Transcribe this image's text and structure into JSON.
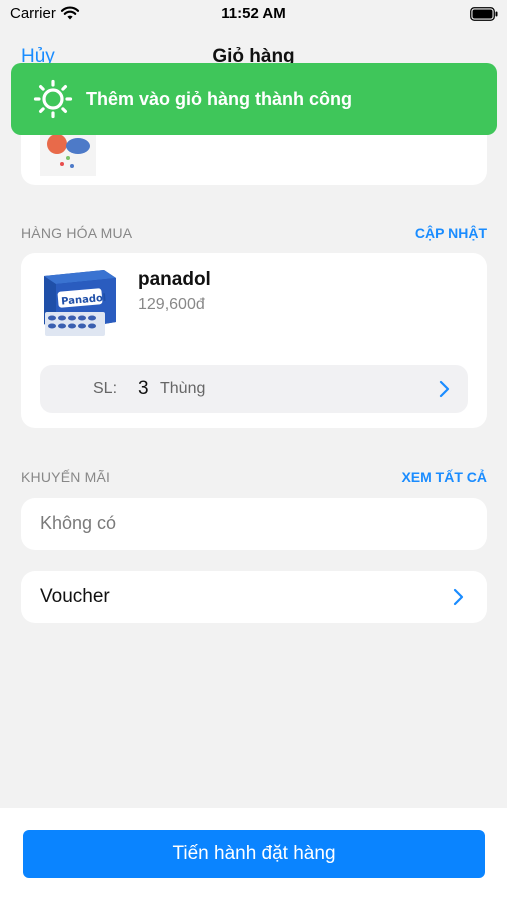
{
  "status_bar": {
    "carrier": "Carrier",
    "time": "11:52 AM"
  },
  "nav": {
    "cancel_label": "Hủy",
    "title": "Giỏ hàng"
  },
  "toast": {
    "message": "Thêm vào giỏ hàng thành công",
    "color": "#3fc65a"
  },
  "purchased_section": {
    "title": "HÀNG HÓA MUA",
    "action_label": "CẬP NHẬT"
  },
  "product": {
    "name": "panadol",
    "price": "129,600đ",
    "quantity_label": "SL:",
    "quantity_value": "3",
    "quantity_unit": "Thùng",
    "image_brand": "Panadol"
  },
  "promotion_section": {
    "title": "KHUYẾN MÃI",
    "action_label": "XEM TẤT CẢ",
    "value": "Không có"
  },
  "voucher": {
    "label": "Voucher"
  },
  "checkout": {
    "button_label": "Tiến hành đặt hàng"
  },
  "colors": {
    "accent": "#0a84ff",
    "link": "#1a8cff",
    "background": "#f2f2f2"
  }
}
